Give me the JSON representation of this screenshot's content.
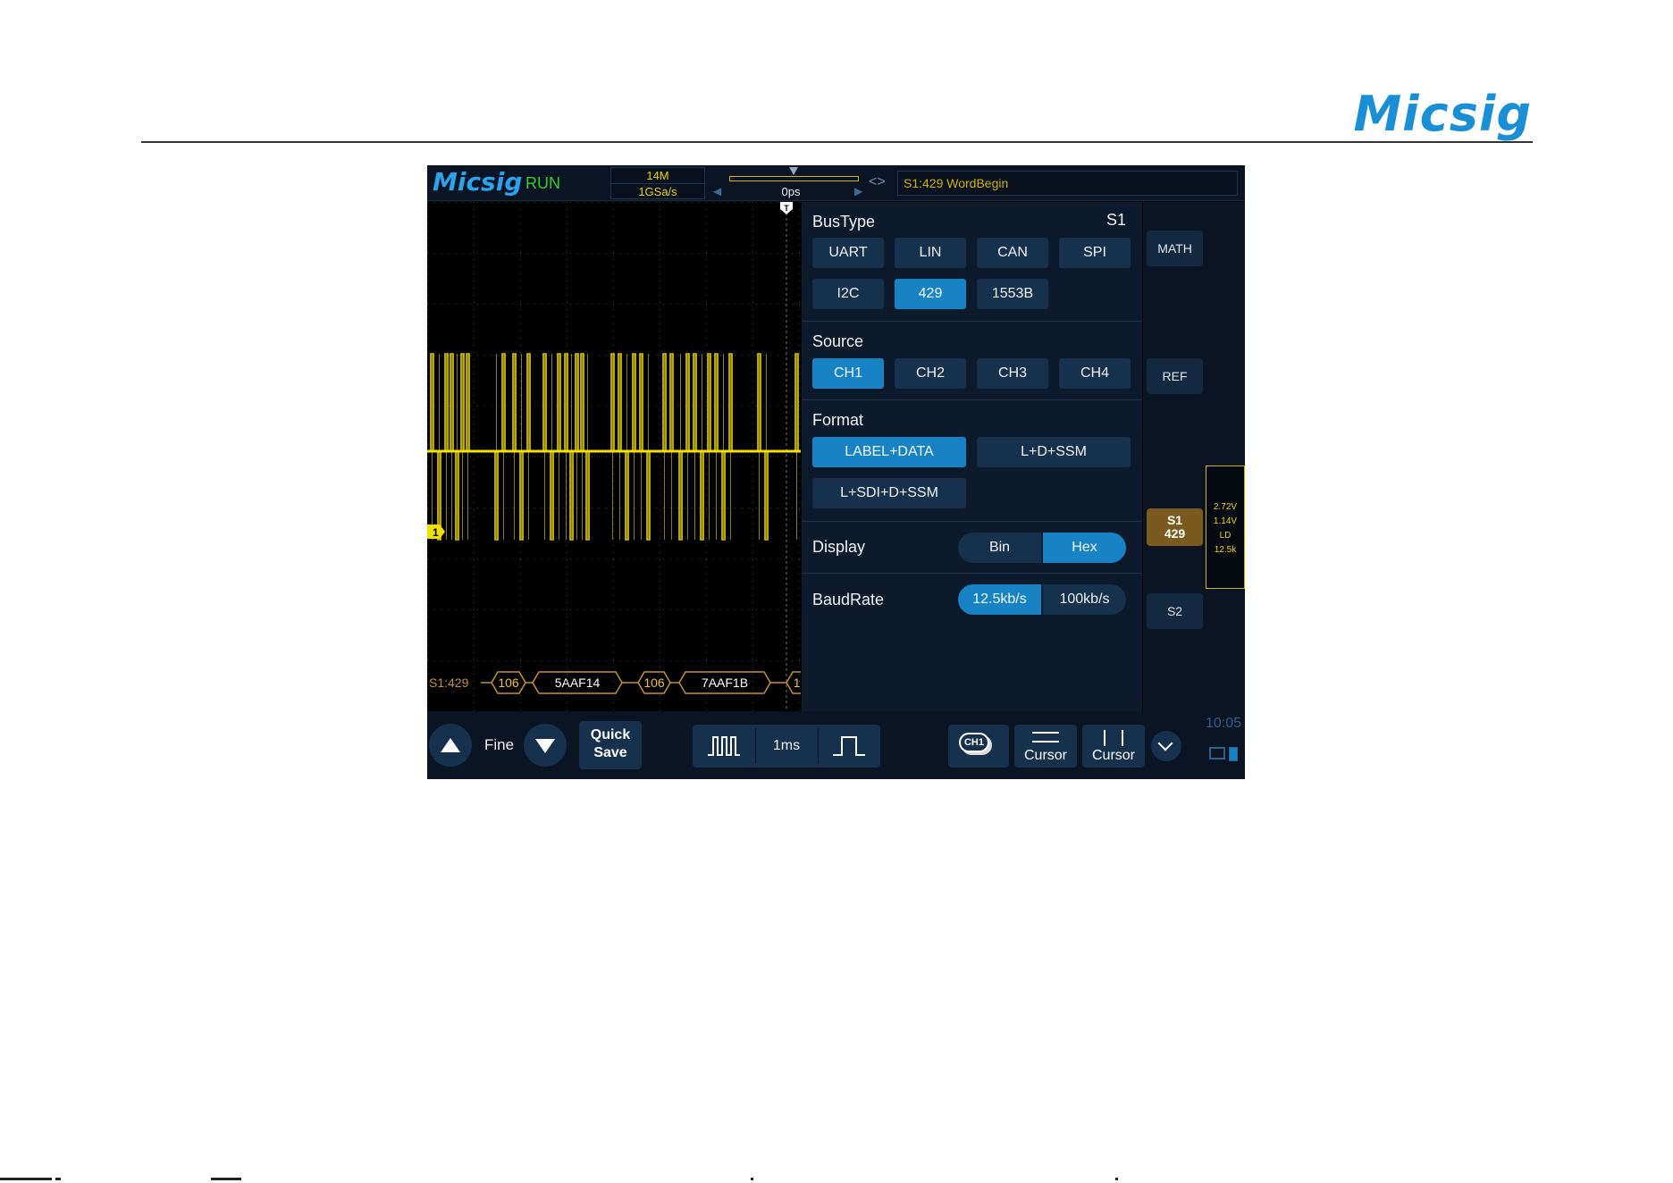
{
  "doc": {
    "brand": "Micsig"
  },
  "scope": {
    "logo": "Micsig",
    "run_state": "RUN",
    "memory_depth": "14M",
    "sample_rate": "1GSa/s",
    "time_offset": "0ps",
    "trigger_info": "S1:429 WordBegin",
    "channel_marker": "1",
    "trigger_marker": "T",
    "decode": {
      "prefix": "S1:429",
      "segments": [
        "106",
        "5AAF14",
        "106",
        "7AAF1B",
        "1("
      ]
    }
  },
  "panel": {
    "bustype": {
      "title": "BusType",
      "serial_tag": "S1",
      "options": [
        "UART",
        "LIN",
        "CAN",
        "SPI",
        "I2C",
        "429",
        "1553B"
      ],
      "selected": "429"
    },
    "source": {
      "title": "Source",
      "options": [
        "CH1",
        "CH2",
        "CH3",
        "CH4"
      ],
      "selected": "CH1"
    },
    "format": {
      "title": "Format",
      "options": [
        "LABEL+DATA",
        "L+D+SSM",
        "L+SDI+D+SSM"
      ],
      "selected": "LABEL+DATA"
    },
    "display": {
      "title": "Display",
      "options": [
        "Bin",
        "Hex"
      ],
      "selected": "Hex"
    },
    "baudrate": {
      "title": "BaudRate",
      "options": [
        "12.5kb/s",
        "100kb/s"
      ],
      "selected": "12.5kb/s"
    }
  },
  "sidebar": {
    "math": "MATH",
    "ref": "REF",
    "s1_line1": "S1",
    "s1_line2": "429",
    "s2": "S2",
    "measure": [
      "2.72V",
      "1.14V",
      "LD",
      "12.5k"
    ]
  },
  "bottombar": {
    "fine": "Fine",
    "quick_save_line1": "Quick",
    "quick_save_line2": "Save",
    "timebase": "1ms",
    "ch1": "CH1",
    "cursor_h": "Cursor",
    "cursor_v": "Cursor",
    "clock": "10:05"
  },
  "colors": {
    "brand_blue": "#1a8fd6",
    "run_green": "#33cc33",
    "trace_yellow": "#e6d000",
    "active_button": "#1783c4",
    "button": "#15314d",
    "decode_orange": "#c8902a"
  }
}
